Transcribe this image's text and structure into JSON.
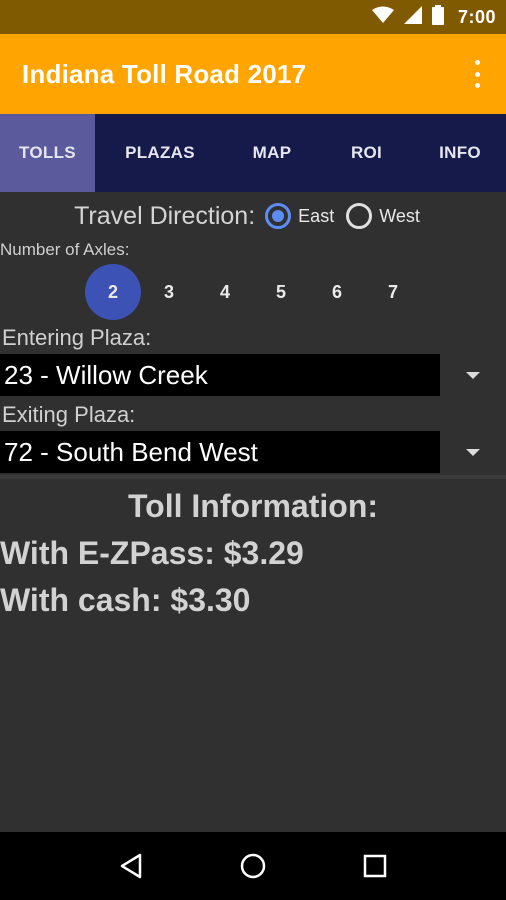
{
  "status_bar": {
    "time": "7:00",
    "icons": [
      "wifi-icon",
      "signal-icon",
      "battery-icon"
    ]
  },
  "app_bar": {
    "title": "Indiana Toll Road 2017",
    "menu_icon": "overflow-menu-icon"
  },
  "tabs": [
    {
      "label": "TOLLS",
      "active": true
    },
    {
      "label": "PLAZAS",
      "active": false
    },
    {
      "label": "MAP",
      "active": false
    },
    {
      "label": "ROI",
      "active": false
    },
    {
      "label": "INFO",
      "active": false
    }
  ],
  "direction": {
    "label": "Travel Direction:",
    "options": [
      {
        "label": "East",
        "checked": true
      },
      {
        "label": "West",
        "checked": false
      }
    ]
  },
  "axles": {
    "label": "Number of Axles:",
    "options": [
      "2",
      "3",
      "4",
      "5",
      "6",
      "7"
    ],
    "selected": "2"
  },
  "entering": {
    "label": "Entering Plaza:",
    "value": "23 - Willow Creek"
  },
  "exiting": {
    "label": "Exiting Plaza:",
    "value": "72 - South Bend West"
  },
  "toll_info": {
    "title": "Toll Information:",
    "ezpass": "With E-ZPass: $3.29",
    "cash": "With cash: $3.30"
  },
  "nav_bar": {
    "icons": [
      "back-icon",
      "home-icon",
      "recents-icon"
    ]
  },
  "colors": {
    "accent": "#ffa400",
    "tab_bg": "#161a4a",
    "tab_active": "#5a5a9c",
    "selected": "#3d52b5",
    "radio": "#5c8df5"
  }
}
